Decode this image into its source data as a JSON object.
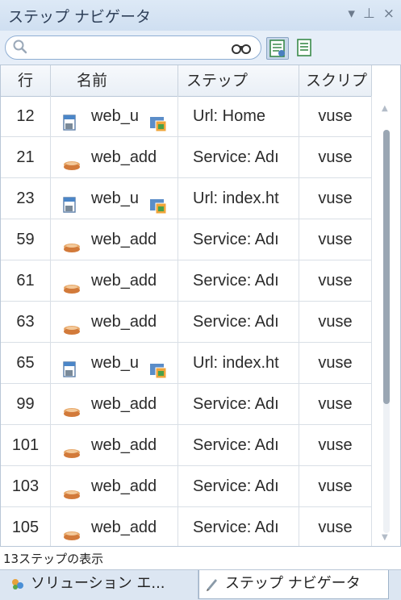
{
  "panel": {
    "title": "ステップ ナビゲータ",
    "controls": {
      "dropdown": "▾",
      "pin": "⊥",
      "close": "×"
    }
  },
  "toolbar": {
    "search_value": "",
    "search_icon": "search-icon",
    "find_icon": "binoculars-icon"
  },
  "table": {
    "headers": {
      "line": "行",
      "name": "名前",
      "step": "ステップ",
      "script": "スクリプ"
    },
    "rows": [
      {
        "line": "12",
        "icon": "web-page-icon",
        "name": "web_u",
        "step": "Url: Home",
        "script": "vuse"
      },
      {
        "line": "21",
        "icon": "web-service-icon",
        "name": "web_add",
        "step": "Service: Adı",
        "script": "vuse"
      },
      {
        "line": "23",
        "icon": "web-page-icon",
        "name": "web_u",
        "step": "Url: index.ht",
        "script": "vuse"
      },
      {
        "line": "59",
        "icon": "web-service-icon",
        "name": "web_add",
        "step": "Service: Adı",
        "script": "vuse"
      },
      {
        "line": "61",
        "icon": "web-service-icon",
        "name": "web_add",
        "step": "Service: Adı",
        "script": "vuse"
      },
      {
        "line": "63",
        "icon": "web-service-icon",
        "name": "web_add",
        "step": "Service: Adı",
        "script": "vuse"
      },
      {
        "line": "65",
        "icon": "web-page-icon",
        "name": "web_u",
        "step": "Url: index.ht",
        "script": "vuse"
      },
      {
        "line": "99",
        "icon": "web-service-icon",
        "name": "web_add",
        "step": "Service: Adı",
        "script": "vuse"
      },
      {
        "line": "101",
        "icon": "web-service-icon",
        "name": "web_add",
        "step": "Service: Adı",
        "script": "vuse"
      },
      {
        "line": "103",
        "icon": "web-service-icon",
        "name": "web_add",
        "step": "Service: Adı",
        "script": "vuse"
      },
      {
        "line": "105",
        "icon": "web-service-icon",
        "name": "web_add",
        "step": "Service: Adı",
        "script": "vuse"
      }
    ]
  },
  "status": {
    "text": "13ステップの表示"
  },
  "tabs": [
    {
      "label": "ソリューション エ...",
      "icon": "solution-explorer-icon",
      "active": false
    },
    {
      "label": "ステップ ナビゲータ",
      "icon": "step-navigator-icon",
      "active": true
    }
  ],
  "colors": {
    "titlebar": "#d6e4f3",
    "accent": "#8faed3",
    "service_icon": "#d9874a"
  }
}
